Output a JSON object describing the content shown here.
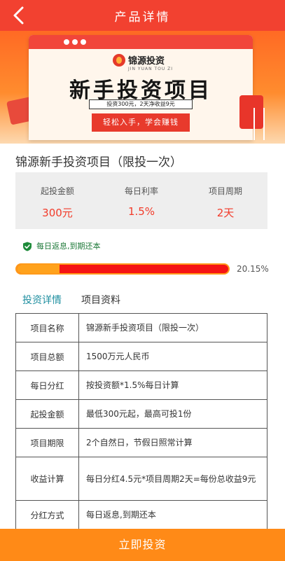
{
  "header": {
    "title": "产品详情",
    "back_icon": "chevron-left-icon",
    "color": "#f24130"
  },
  "banner": {
    "logo_text": "锦源投资",
    "logo_sub": "JIN YUAN TOU ZI",
    "headline": "新手投资项目",
    "subline": "投资300元，2天净收益9元",
    "button_text": "轻松入手，学会赚钱"
  },
  "product": {
    "title": "锦源新手投资项目（限投一次）"
  },
  "stats": [
    {
      "label": "起投金额",
      "value": "300元"
    },
    {
      "label": "每日利率",
      "value": "1.5%"
    },
    {
      "label": "项目周期",
      "value": "2天"
    }
  ],
  "note": {
    "icon": "shield-check-icon",
    "text": "每日返息,到期还本"
  },
  "progress": {
    "fraction": 0.2015,
    "text": "20.15%"
  },
  "tabs": [
    {
      "label": "投资详情",
      "active": true
    },
    {
      "label": "项目资料",
      "active": false
    }
  ],
  "details": [
    {
      "key": "项目名称",
      "value": "锦源新手投资项目（限投一次）"
    },
    {
      "key": "项目总额",
      "value": "1500万元人民币"
    },
    {
      "key": "每日分红",
      "value": "按投资额*1.5%每日计算"
    },
    {
      "key": "起投金额",
      "value": "最低300元起，最高可投1份"
    },
    {
      "key": "项目期限",
      "value": "2个自然日，节假日照常计算"
    },
    {
      "key": "收益计算",
      "value": "每日分红4.5元*项目周期2天=每份总收益9元"
    },
    {
      "key": "分红方式",
      "value": "每日返息,到期还本"
    }
  ],
  "footer": {
    "button_label": "立即投资",
    "color": "#ff8a17"
  },
  "colors": {
    "accent_red": "#f23b2a",
    "progress_fill": "#ffa21c",
    "tab_active": "#1f8fa0"
  }
}
